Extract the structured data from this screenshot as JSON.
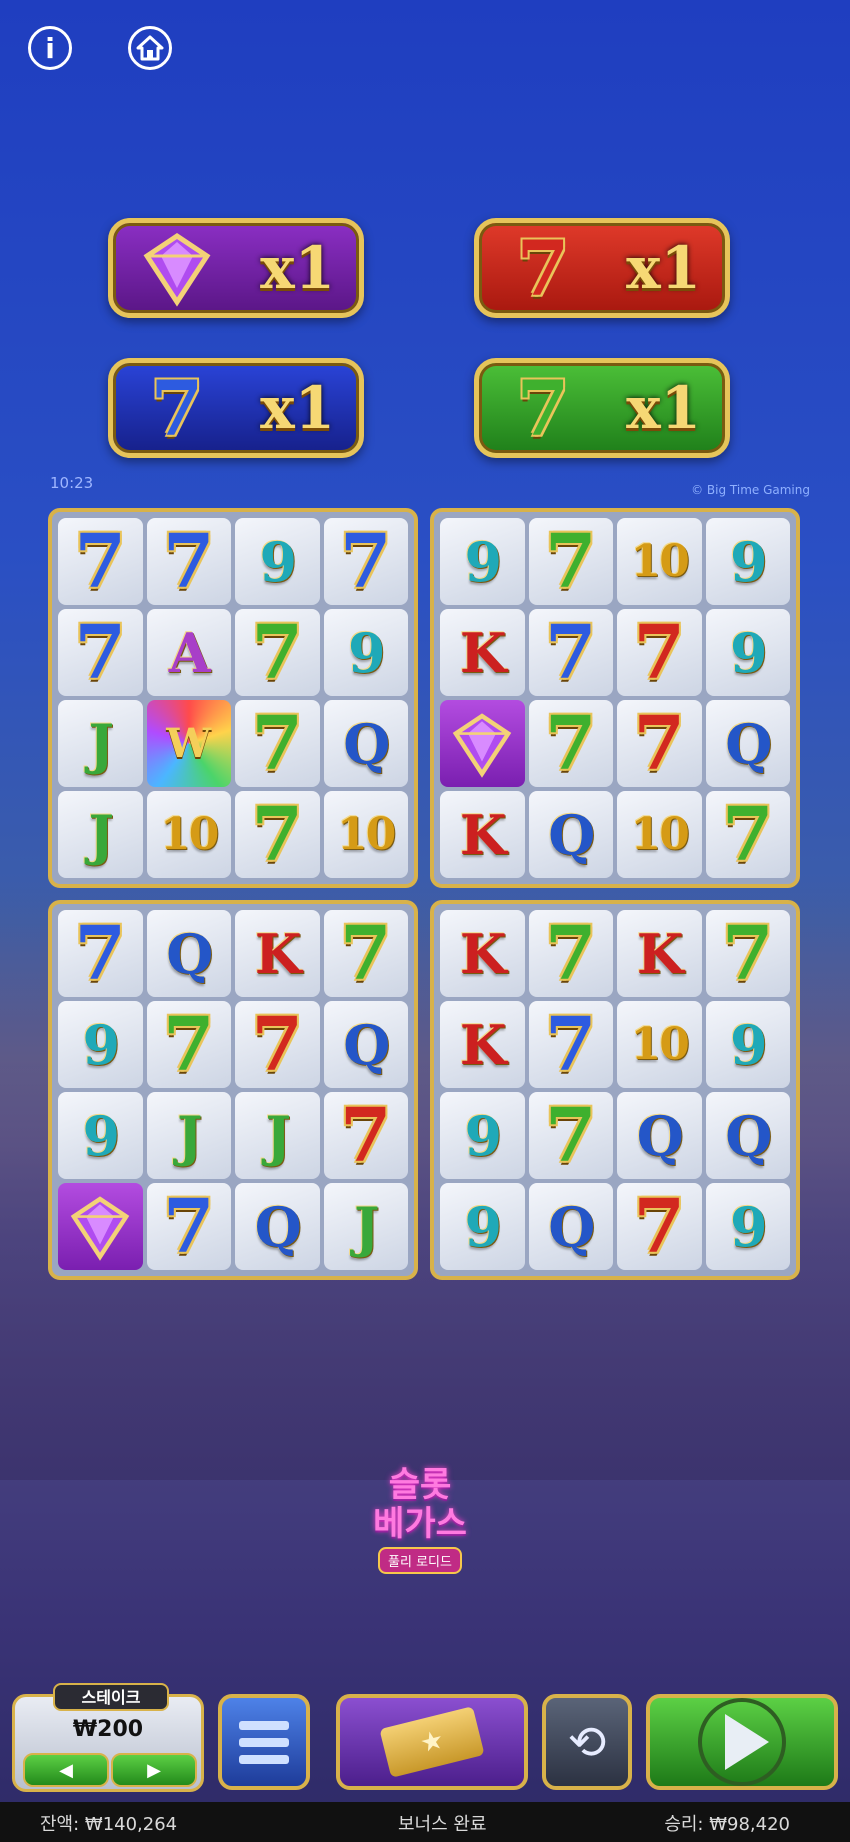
{
  "top_buttons": {
    "info_icon": "i",
    "home_icon": "home-icon"
  },
  "multipliers": [
    {
      "symbol": "gem",
      "color": "purple",
      "value": "x1"
    },
    {
      "symbol": "7",
      "color": "red",
      "value": "x1"
    },
    {
      "symbol": "7",
      "color": "blue",
      "value": "x1"
    },
    {
      "symbol": "7",
      "color": "green",
      "value": "x1"
    }
  ],
  "clock": "10:23",
  "brand": "© Big Time Gaming",
  "grids": [
    [
      [
        "7b",
        "7b",
        "9",
        "7b"
      ],
      [
        "7b",
        "A",
        "7g",
        "9"
      ],
      [
        "J",
        "W",
        "7g",
        "Q"
      ],
      [
        "J",
        "10",
        "7g",
        "10"
      ]
    ],
    [
      [
        "9",
        "7g",
        "10",
        "9"
      ],
      [
        "K",
        "7b",
        "7r",
        "9"
      ],
      [
        "gem",
        "7g",
        "7r",
        "Q"
      ],
      [
        "K",
        "Q",
        "10",
        "7g"
      ]
    ],
    [
      [
        "7b",
        "Q",
        "K",
        "7g"
      ],
      [
        "9",
        "7g",
        "7r",
        "Q"
      ],
      [
        "9",
        "J",
        "J",
        "7r"
      ],
      [
        "gem",
        "7b",
        "Q",
        "J"
      ]
    ],
    [
      [
        "K",
        "7g",
        "K",
        "7g"
      ],
      [
        "K",
        "7b",
        "10",
        "9"
      ],
      [
        "9",
        "7g",
        "Q",
        "Q"
      ],
      [
        "9",
        "Q",
        "7r",
        "9"
      ]
    ]
  ],
  "logo": {
    "line1": "슬롯",
    "line2": "베가스",
    "line3": "풀리 로디드"
  },
  "controls": {
    "stake_label": "스테이크",
    "stake_value": "₩200",
    "left_arrow": "◀",
    "right_arrow": "▶",
    "autoplay_icon": "⟲"
  },
  "status_bar": {
    "balance": "잔액: ₩140,264",
    "center": "보너스 완료",
    "win": "승리: ₩98,420"
  },
  "colors": {
    "seven_blue": "#2d5be0",
    "seven_green": "#3fb02e",
    "seven_red": "#d2281f",
    "nine": "#1fa9b8",
    "ten": "#d59b16",
    "jack": "#39a83a",
    "queen": "#2456c8",
    "king": "#cc2020",
    "ace": "#a83fc8",
    "gold": "#e6c45a"
  }
}
